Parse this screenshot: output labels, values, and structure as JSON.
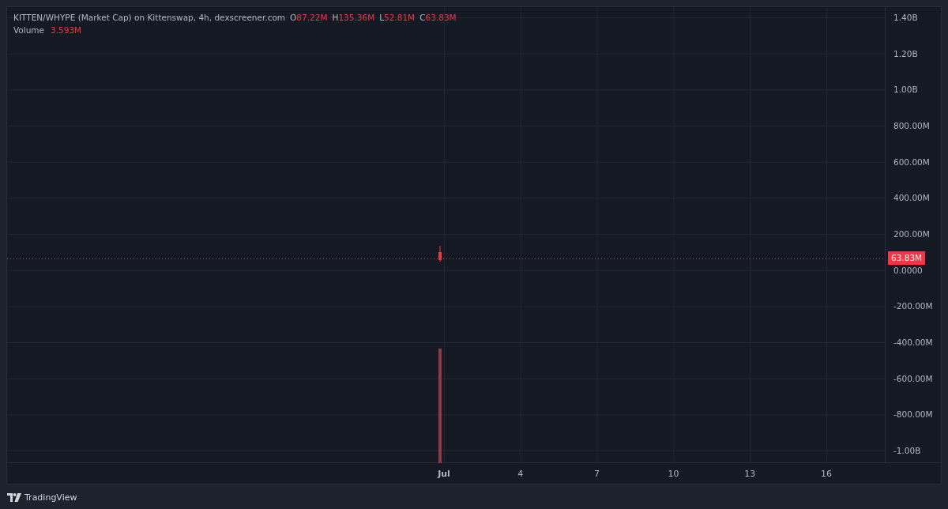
{
  "legend": {
    "title": "KITTEN/WHYPE (Market Cap) on Kittenswap, 4h, dexscreener.com",
    "ohlc": [
      {
        "label": "O",
        "value": "87.22M"
      },
      {
        "label": "H",
        "value": "135.36M"
      },
      {
        "label": "L",
        "value": "52.81M"
      },
      {
        "label": "C",
        "value": "63.83M"
      }
    ],
    "volume": {
      "label": "Volume",
      "value": "3.593M"
    }
  },
  "price_axis": {
    "labels": [
      "1.40B",
      "1.20B",
      "1.00B",
      "800.00M",
      "600.00M",
      "400.00M",
      "200.00M",
      "0.0000",
      "-200.00M",
      "-400.00M",
      "-600.00M",
      "-800.00M",
      "-1.00B"
    ],
    "last_price": "63.83M"
  },
  "time_axis": {
    "labels": [
      {
        "text": "Jul",
        "bold": true
      },
      {
        "text": "4",
        "bold": false
      },
      {
        "text": "7",
        "bold": false
      },
      {
        "text": "10",
        "bold": false
      },
      {
        "text": "13",
        "bold": false
      },
      {
        "text": "16",
        "bold": false
      }
    ]
  },
  "footer": {
    "brand": "TradingView"
  }
}
